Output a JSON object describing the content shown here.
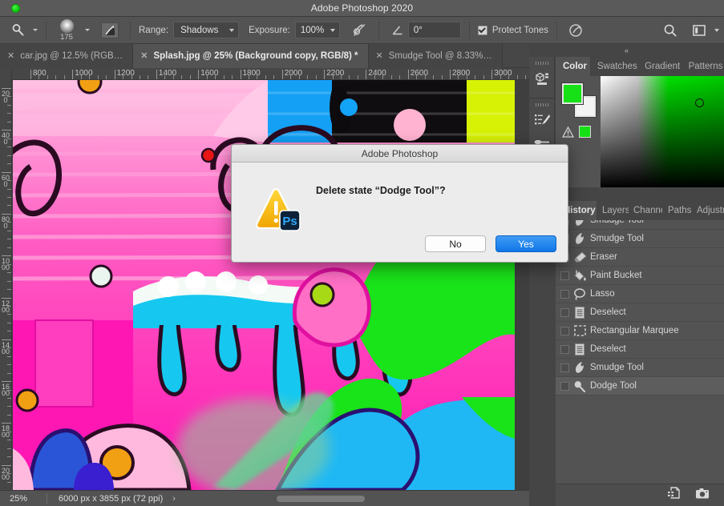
{
  "window": {
    "title": "Adobe Photoshop 2020",
    "traffic_light_color": "#13d413"
  },
  "options_bar": {
    "tool_icon": "dodge-tool-icon",
    "brush_size": "175",
    "airbrush_icon": "airbrush-toggle-icon",
    "range_label": "Range:",
    "range_value": "Shadows",
    "exposure_label": "Exposure:",
    "exposure_value": "100%",
    "pressure_exposure_icon": "pressure-controls-exposure-icon",
    "angle_icon": "brush-angle-icon",
    "angle_value": "0°",
    "protect_tones_label": "Protect Tones",
    "protect_tones_checked": true,
    "pressure_size_icon": "pressure-controls-size-icon",
    "search_icon": "search-icon",
    "workspace_icon": "workspace-switcher-icon",
    "overflow_icon": "chevron-down-icon"
  },
  "tabs": [
    {
      "label": "car.jpg @ 12.5% (RGB…",
      "active": false,
      "close_icon": "close-icon"
    },
    {
      "label": "Splash.jpg @ 25% (Background copy, RGB/8) *",
      "active": true,
      "close_icon": "close-icon"
    },
    {
      "label": "Smudge Tool @ 8.33%…",
      "active": false,
      "close_icon": "close-icon"
    }
  ],
  "rulers": {
    "horizontal_labels": [
      "800",
      "1000",
      "1200",
      "1400",
      "1600",
      "1800",
      "2000",
      "2200",
      "2400",
      "2600",
      "2800",
      "3000"
    ],
    "vertical_labels": [
      "200",
      "400",
      "600",
      "800",
      "1000",
      "1200",
      "1400",
      "1600",
      "1800",
      "2000"
    ]
  },
  "status_bar": {
    "zoom": "25%",
    "dimensions": "6000 px x 3855 px (72 ppi)",
    "expand_icon": "chevron-right-icon"
  },
  "dock": {
    "collapse_icon": "collapse-panels-icon",
    "rail_icons": [
      "libraries-icon",
      "brush-settings-icon",
      "brush-presets-icon"
    ]
  },
  "color_panel": {
    "tabs": [
      {
        "label": "Color",
        "active": true
      },
      {
        "label": "Swatches",
        "active": false
      },
      {
        "label": "Gradient",
        "active": false
      },
      {
        "label": "Patterns",
        "active": false
      }
    ],
    "foreground_color": "#16e016",
    "background_color": "#f3f3f3",
    "warning_icon": "out-of-gamut-warning-icon",
    "warning_swatch_color": "#16e016",
    "picker_icon": "color-picker-ring-icon"
  },
  "history_panel": {
    "tabs": [
      {
        "label": "History",
        "active": true
      },
      {
        "label": "Layers",
        "active": false
      },
      {
        "label": "Channels",
        "active": false
      },
      {
        "label": "Paths",
        "active": false
      },
      {
        "label": "Adjustments",
        "active": false
      }
    ],
    "items": [
      {
        "label": "Smudge Tool",
        "icon": "smudge-tool-icon",
        "selected": false,
        "clipped": true
      },
      {
        "label": "Smudge Tool",
        "icon": "smudge-tool-icon",
        "selected": false
      },
      {
        "label": "Eraser",
        "icon": "eraser-icon",
        "selected": false
      },
      {
        "label": "Paint Bucket",
        "icon": "paint-bucket-icon",
        "selected": false
      },
      {
        "label": "Lasso",
        "icon": "lasso-icon",
        "selected": false
      },
      {
        "label": "Deselect",
        "icon": "deselect-icon",
        "selected": false
      },
      {
        "label": "Rectangular Marquee",
        "icon": "rectangular-marquee-icon",
        "selected": false
      },
      {
        "label": "Deselect",
        "icon": "deselect-icon",
        "selected": false
      },
      {
        "label": "Smudge Tool",
        "icon": "smudge-tool-icon",
        "selected": false
      },
      {
        "label": "Dodge Tool",
        "icon": "dodge-tool-icon",
        "selected": true
      }
    ],
    "footer_icons": [
      "create-document-from-state-icon",
      "create-snapshot-icon"
    ]
  },
  "dialog": {
    "title": "Adobe Photoshop",
    "message": "Delete state “Dodge Tool”?",
    "warning_icon": "warning-triangle-icon",
    "app_badge": "Ps",
    "buttons": [
      {
        "label": "No",
        "primary": false
      },
      {
        "label": "Yes",
        "primary": true
      }
    ]
  }
}
